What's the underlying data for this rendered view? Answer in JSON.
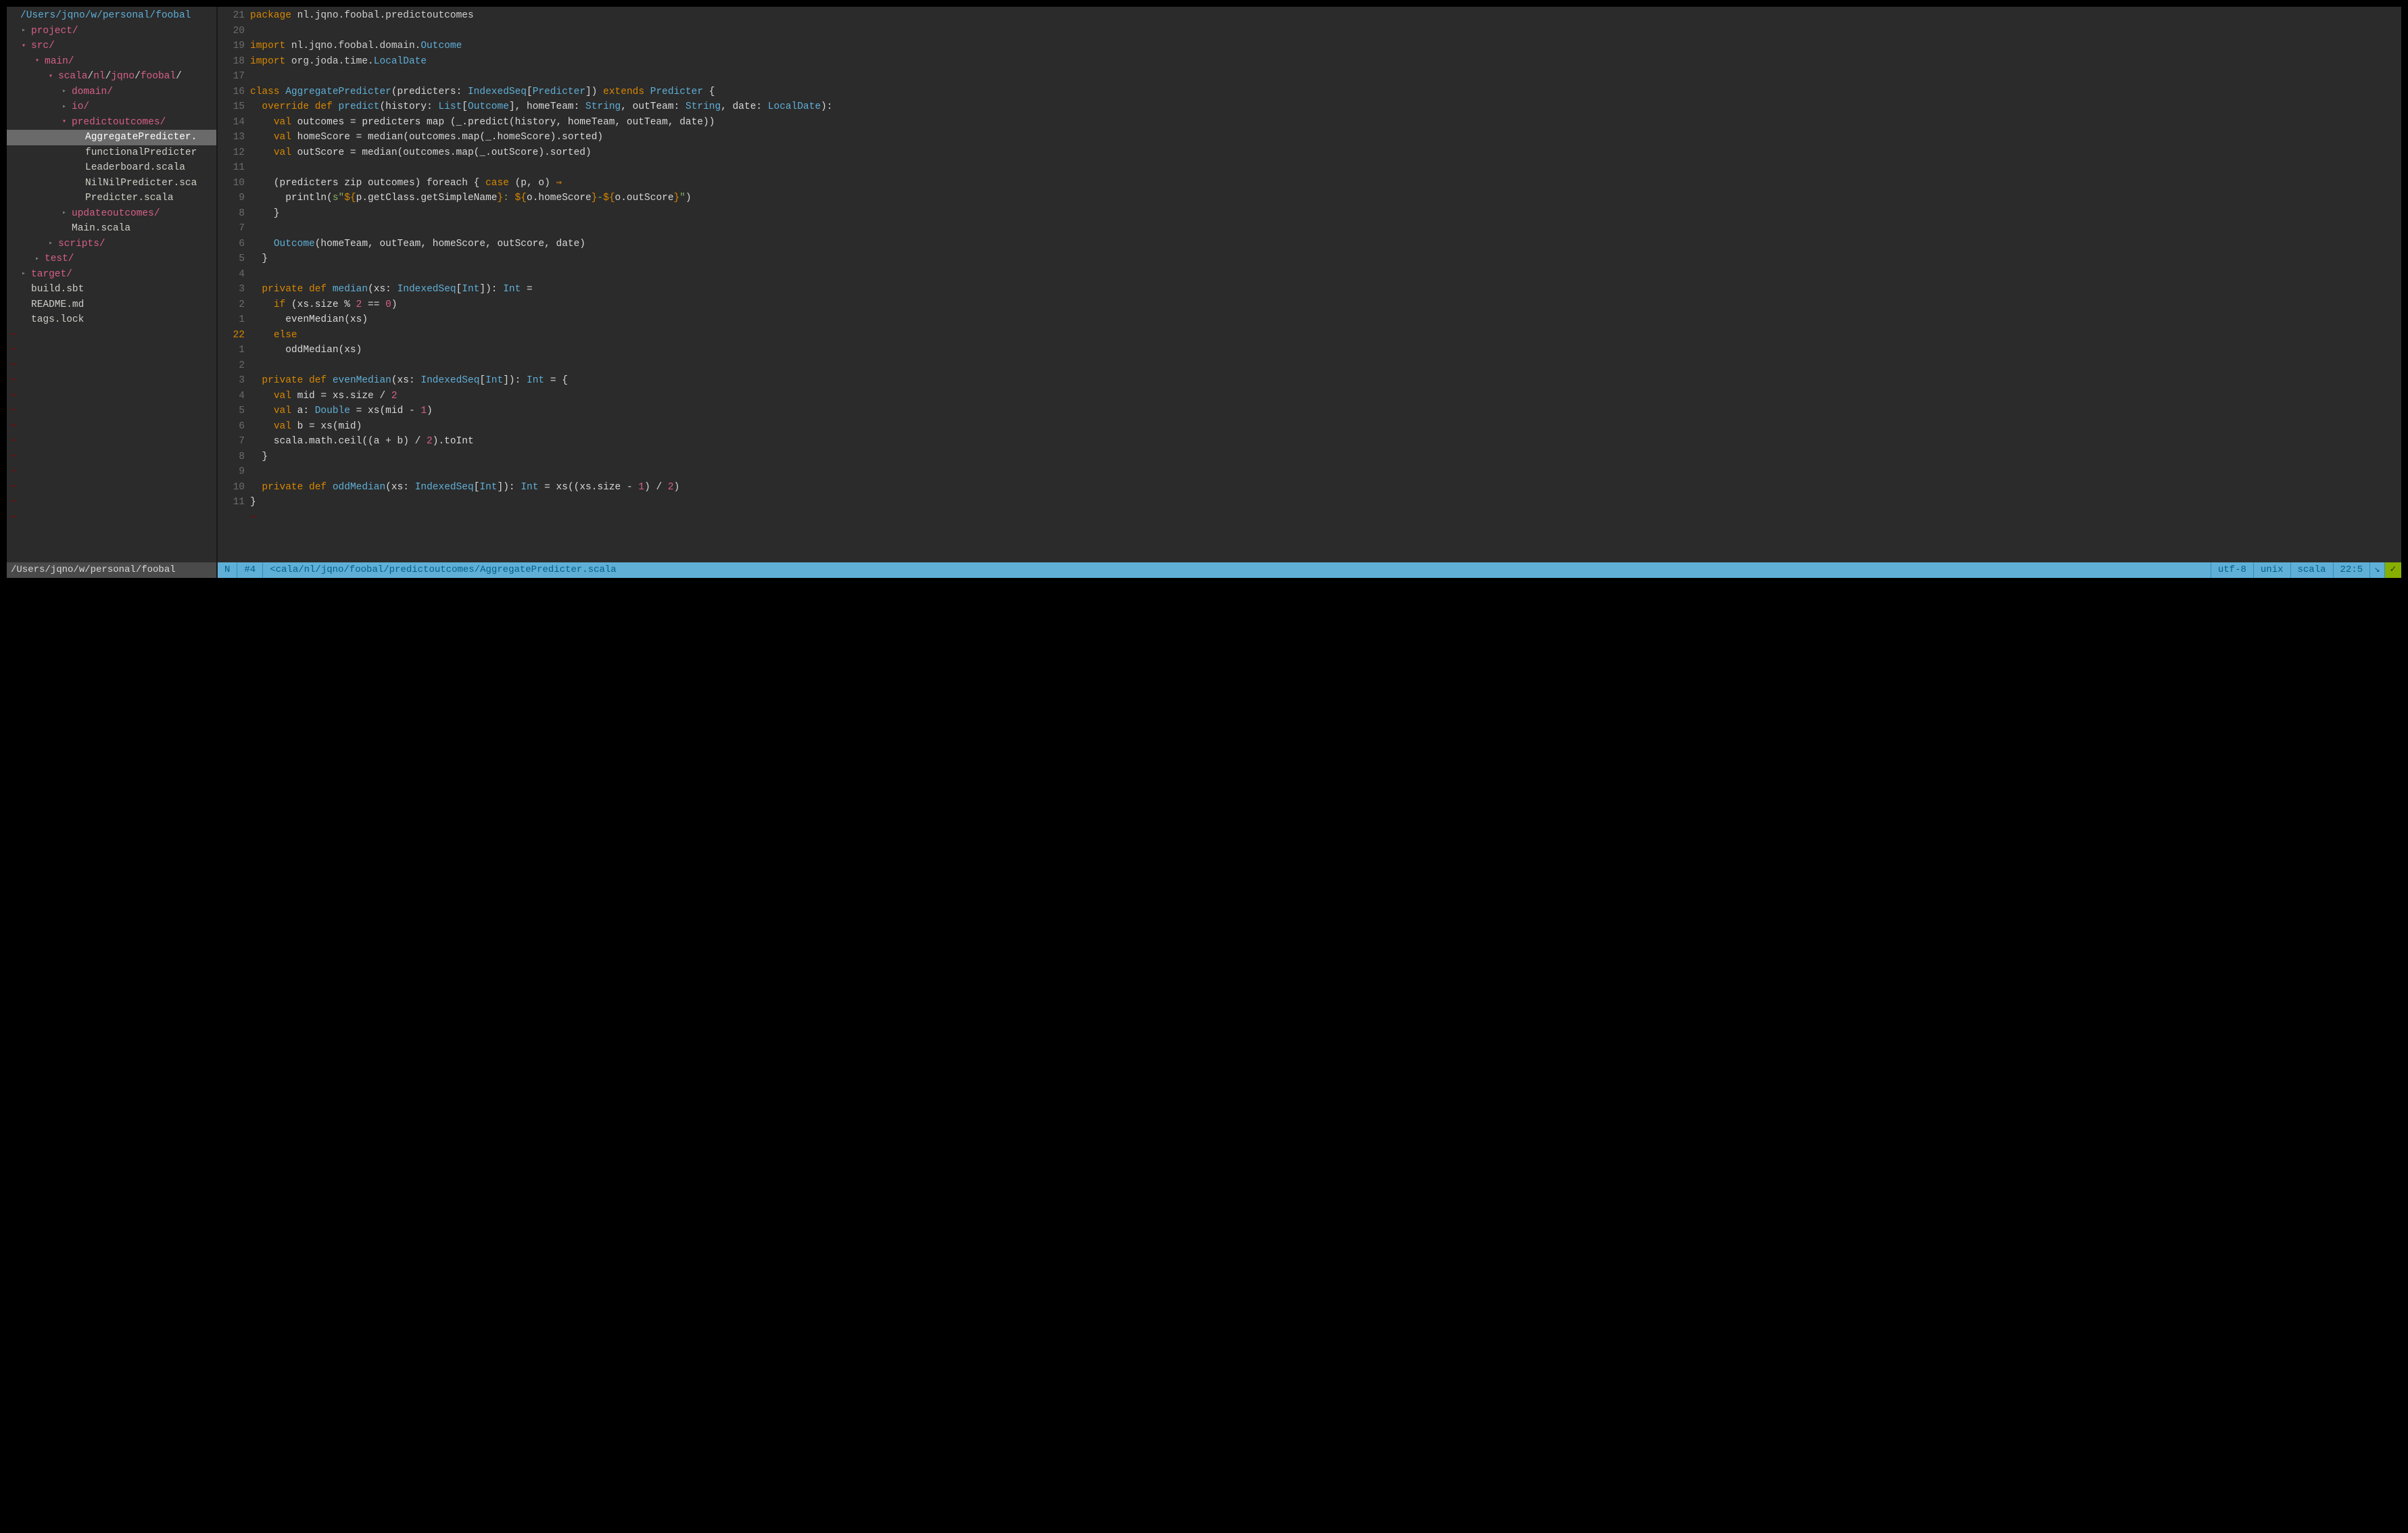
{
  "tree": {
    "root": "/Users/jqno/w/personal/foobal",
    "items": [
      {
        "depth": 0,
        "arrow": "",
        "label": "/Users/jqno/w/personal/foobal",
        "color": "c-blue",
        "interact": false
      },
      {
        "depth": 1,
        "arrow": "▸",
        "label": "project/",
        "color": "c-magenta",
        "interact": true
      },
      {
        "depth": 1,
        "arrow": "▾",
        "label": "src/",
        "color": "c-magenta",
        "interact": true
      },
      {
        "depth": 2,
        "arrow": "▾",
        "label": "main/",
        "color": "c-magenta",
        "interact": true
      },
      {
        "depth": 3,
        "arrow": "▾",
        "label": "scala/nl/jqno/foobal/",
        "color": "c-magenta",
        "slashed": true,
        "interact": true
      },
      {
        "depth": 4,
        "arrow": "▸",
        "label": "domain/",
        "color": "c-magenta",
        "interact": true
      },
      {
        "depth": 4,
        "arrow": "▸",
        "label": "io/",
        "color": "c-magenta",
        "interact": true
      },
      {
        "depth": 4,
        "arrow": "▾",
        "label": "predictoutcomes/",
        "color": "c-magenta",
        "interact": true
      },
      {
        "depth": 5,
        "arrow": "",
        "label": "AggregatePredicter.",
        "color": "sel",
        "selected": true,
        "interact": true
      },
      {
        "depth": 5,
        "arrow": "",
        "label": "functionalPredicter",
        "color": "c-softwhite",
        "interact": true
      },
      {
        "depth": 5,
        "arrow": "",
        "label": "Leaderboard.scala",
        "color": "c-softwhite",
        "interact": true
      },
      {
        "depth": 5,
        "arrow": "",
        "label": "NilNilPredicter.sca",
        "color": "c-softwhite",
        "interact": true
      },
      {
        "depth": 5,
        "arrow": "",
        "label": "Predicter.scala",
        "color": "c-softwhite",
        "interact": true
      },
      {
        "depth": 4,
        "arrow": "▸",
        "label": "updateoutcomes/",
        "color": "c-magenta",
        "interact": true
      },
      {
        "depth": 4,
        "arrow": "",
        "label": "Main.scala",
        "color": "c-softwhite",
        "interact": true
      },
      {
        "depth": 3,
        "arrow": "▸",
        "label": "scripts/",
        "color": "c-magenta",
        "interact": true
      },
      {
        "depth": 2,
        "arrow": "▸",
        "label": "test/",
        "color": "c-magenta",
        "interact": true
      },
      {
        "depth": 1,
        "arrow": "▸",
        "label": "target/",
        "color": "c-magenta",
        "interact": true
      },
      {
        "depth": 1,
        "arrow": "",
        "label": "build.sbt",
        "color": "c-softwhite",
        "interact": true
      },
      {
        "depth": 1,
        "arrow": "",
        "label": "README.md",
        "color": "c-softwhite",
        "interact": true
      },
      {
        "depth": 1,
        "arrow": "",
        "label": "tags.lock",
        "color": "c-softwhite",
        "interact": true
      }
    ],
    "tilde_count": 13
  },
  "gutter": [
    "21",
    "20",
    "19",
    "18",
    "17",
    "16",
    "15",
    "14",
    "13",
    "12",
    "11",
    "10",
    "9",
    "8",
    "7",
    "6",
    "5",
    "4",
    "3",
    "2",
    "1",
    "22",
    "1",
    "2",
    "3",
    "4",
    "5",
    "6",
    "7",
    "8",
    "9",
    "10",
    "11"
  ],
  "gutter_current_index": 21,
  "code_tilde": "~",
  "code_lines_html": [
    "<span class='kw'>package</span> <span class='op'>nl.jqno.foobal.predictoutcomes</span>",
    "",
    "<span class='kw'>import</span> <span class='op'>nl.jqno.foobal.domain.</span><span class='typ'>Outcome</span>",
    "<span class='kw'>import</span> <span class='op'>org.joda.time.</span><span class='typ'>LocalDate</span>",
    "",
    "<span class='kw'>class</span> <span class='typ'>AggregatePredicter</span>(predicters: <span class='typ'>IndexedSeq</span>[<span class='typ'>Predicter</span>]) <span class='kw'>extends</span> <span class='typ'>Predicter</span> {",
    "  <span class='kw'>override</span> <span class='kw'>def</span> <span class='fn'>predict</span>(history: <span class='typ'>List</span>[<span class='typ'>Outcome</span>], homeTeam: <span class='typ'>String</span>, outTeam: <span class='typ'>String</span>, date: <span class='typ'>LocalDate</span>):",
    "    <span class='kw'>val</span> outcomes = predicters map (_.predict(history, homeTeam, outTeam, date))",
    "    <span class='kw'>val</span> homeScore = median(outcomes.map(_.homeScore).sorted)",
    "    <span class='kw'>val</span> outScore = median(outcomes.map(_.outScore).sorted)",
    "",
    "    (predicters zip outcomes) foreach { <span class='kw'>case</span> (p, o) <span class='sym'>⇒</span>",
    "      println(<span class='str'>s\"</span><span class='interp'>${</span>p.getClass.getSimpleName<span class='interp'>}</span><span class='str'>: </span><span class='interp'>${</span>o.homeScore<span class='interp'>}</span><span class='str'>-</span><span class='interp'>${</span>o.outScore<span class='interp'>}</span><span class='str'>\"</span>)",
    "    }",
    "",
    "    <span class='typ'>Outcome</span>(homeTeam, outTeam, homeScore, outScore, date)",
    "  }",
    "",
    "  <span class='kw'>private</span> <span class='kw'>def</span> <span class='fn'>median</span>(xs: <span class='typ'>IndexedSeq</span>[<span class='typ'>Int</span>]): <span class='typ'>Int</span> =",
    "    <span class='kw'>if</span> (xs.size % <span class='num'>2</span> == <span class='num'>0</span>)",
    "      evenMedian(xs)",
    "    <span class='kw'>else</span>",
    "      oddMedian(xs)",
    "",
    "  <span class='kw'>private</span> <span class='kw'>def</span> <span class='fn'>evenMedian</span>(xs: <span class='typ'>IndexedSeq</span>[<span class='typ'>Int</span>]): <span class='typ'>Int</span> = {",
    "    <span class='kw'>val</span> mid = xs.size / <span class='num'>2</span>",
    "    <span class='kw'>val</span> a: <span class='typ'>Double</span> = xs(mid - <span class='num'>1</span>)",
    "    <span class='kw'>val</span> b = xs(mid)",
    "    scala.math.ceil((a + b) / <span class='num'>2</span>).toInt",
    "  }",
    "",
    "  <span class='kw'>private</span> <span class='kw'>def</span> <span class='fn'>oddMedian</span>(xs: <span class='typ'>IndexedSeq</span>[<span class='typ'>Int</span>]): <span class='typ'>Int</span> = xs((xs.size - <span class='num'>1</span>) / <span class='num'>2</span>)",
    "}"
  ],
  "status": {
    "left": "/Users/jqno/w/personal/foobal",
    "mode": "N",
    "bufnum": "#4",
    "path": "<cala/nl/jqno/foobal/predictoutcomes/AggregatePredicter.scala",
    "encoding": "utf-8",
    "fileformat": "unix",
    "filetype": "scala",
    "position": "22:5",
    "arrow": "↘",
    "check": "✓"
  },
  "tilde": "~"
}
